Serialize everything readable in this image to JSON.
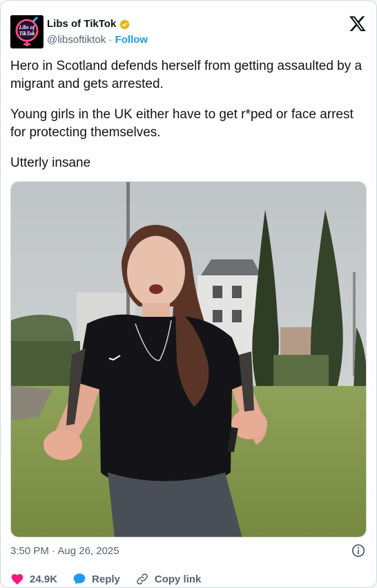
{
  "author": {
    "name": "Libs of TikTok",
    "handle": "@libsoftiktok",
    "separator": "·",
    "follow_label": "Follow",
    "avatar_text_line1": "Libs of",
    "avatar_text_line2": "TikTok",
    "verified_icon": "gold-verified-badge-icon"
  },
  "tweet": {
    "paragraphs": [
      "Hero in Scotland defends herself from getting assaulted by a migrant and gets arrested.",
      "Young girls in the UK either have to get r*ped or face arrest for protecting themselves.",
      "Utterly insane"
    ],
    "timestamp": "3:50 PM · Aug 26, 2025"
  },
  "actions": {
    "like_count": "24.9K",
    "reply_label": "Reply",
    "copy_label": "Copy link"
  },
  "colors": {
    "accent": "#1d9bf0",
    "like": "#f91880",
    "verified_gold": "#e2b719",
    "muted_text": "#536471"
  },
  "icons": [
    "x-logo-icon",
    "info-icon",
    "heart-icon",
    "reply-bubble-icon",
    "link-icon"
  ]
}
